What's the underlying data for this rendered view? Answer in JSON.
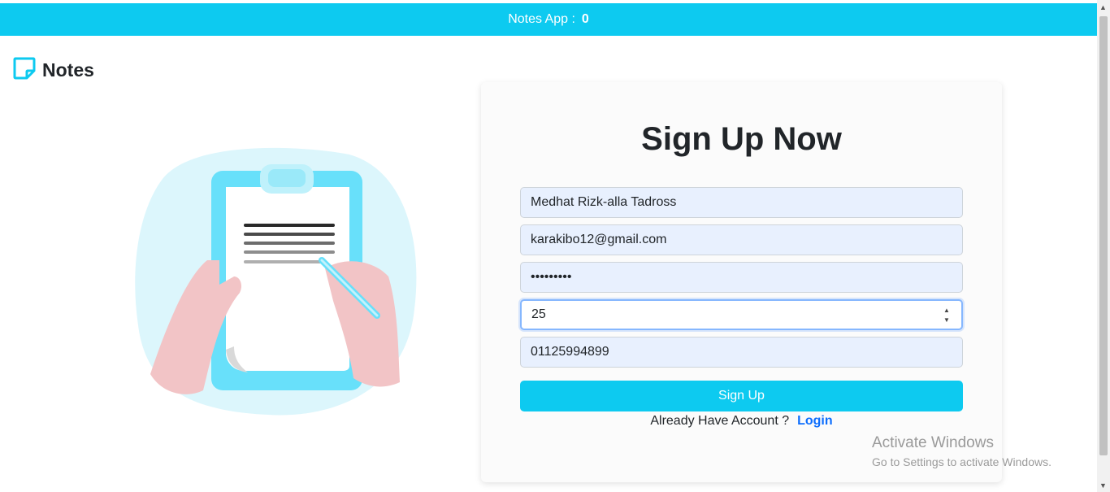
{
  "header": {
    "app_label": "Notes App :",
    "count": "0"
  },
  "brand": {
    "title": "Notes",
    "icon": "sticky-note-icon"
  },
  "form": {
    "title": "Sign Up Now",
    "name_value": "Medhat Rizk-alla Tadross",
    "email_value": "karakibo12@gmail.com",
    "password_value": "•••••••••",
    "age_value": "25",
    "phone_value": "01125994899",
    "submit_label": "Sign Up",
    "footer_text": "Already Have Account ?",
    "login_label": "Login"
  },
  "watermark": {
    "line1": "Activate Windows",
    "line2": "Go to Settings to activate Windows."
  },
  "colors": {
    "accent": "#0dcaf0",
    "link": "#0d6efd",
    "field_bg": "#e8f0fe"
  }
}
